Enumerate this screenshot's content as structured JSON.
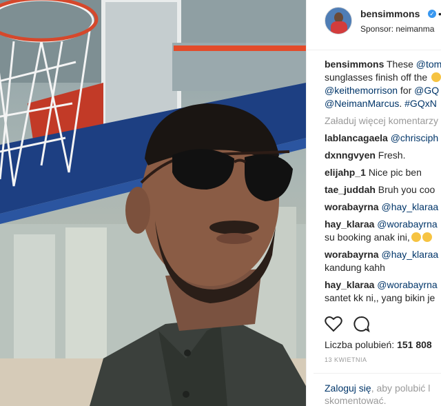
{
  "post": {
    "username": "bensimmons",
    "dot": "•",
    "sponsor": "Sponsor: neimanma"
  },
  "caption": {
    "username": "bensimmons",
    "text1": " These ",
    "mention1": "@tom",
    "text2": "sunglasses finish off the ",
    "mention2": "@keithemorrison",
    "text3": " for ",
    "mention3": "@GQ",
    "mention4": "@NeimanMarcus",
    "text4": ". ",
    "hashtag": "#GQxN"
  },
  "load_more": "Załaduj więcej komentarzy",
  "comments": [
    {
      "user": "lablancagaela",
      "mention": "@chrisciph",
      "text": ""
    },
    {
      "user": "dxnngvyen",
      "mention": "",
      "text": "Fresh."
    },
    {
      "user": "elijahp_1",
      "mention": "",
      "text": "Nice pic ben"
    },
    {
      "user": "tae_juddah",
      "mention": "",
      "text": "Bruh you coo"
    },
    {
      "user": "worabayrna",
      "mention": "@hay_klaraa",
      "text": ""
    },
    {
      "user": "hay_klaraa",
      "mention": "@worabayrna",
      "text": "",
      "line2": "su booking anak ini,"
    },
    {
      "user": "worabayrna",
      "mention": "@hay_klaraa",
      "text": "",
      "line2": "kandung kahh"
    },
    {
      "user": "hay_klaraa",
      "mention": "@worabayrna",
      "text": "",
      "line2": "santet kk ni,, yang bikin je"
    }
  ],
  "icons": {
    "like": "heart-icon",
    "comment": "comment-bubble-icon"
  },
  "likes": {
    "label": "Liczba polubień: ",
    "count": "151 808"
  },
  "date": "13 KWIETNIA",
  "login": {
    "link": "Zaloguj się",
    "text": ", aby polubić l",
    "line2": "skomentować."
  }
}
